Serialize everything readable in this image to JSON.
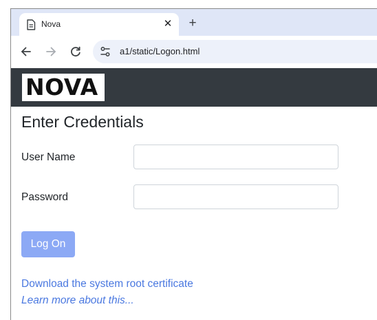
{
  "browser": {
    "tab": {
      "title": "Nova",
      "close_glyph": "✕",
      "icon": "document-icon"
    },
    "new_tab_glyph": "+",
    "nav": {
      "back_icon": "arrow-left-icon",
      "forward_icon": "arrow-right-icon",
      "reload_icon": "reload-icon"
    },
    "address": {
      "site_info_icon": "tune-icon",
      "url": "a1/static/Logon.html"
    }
  },
  "header": {
    "logo_text": "NOVA",
    "background": "#343a40"
  },
  "form": {
    "title": "Enter Credentials",
    "username_label": "User Name",
    "username_value": "",
    "password_label": "Password",
    "password_value": "",
    "submit_label": "Log On",
    "submit_color": "#8ca9f5"
  },
  "links": {
    "certificate": "Download the system root certificate",
    "learn_more": "Learn more about this...",
    "color": "#4a78e0"
  }
}
